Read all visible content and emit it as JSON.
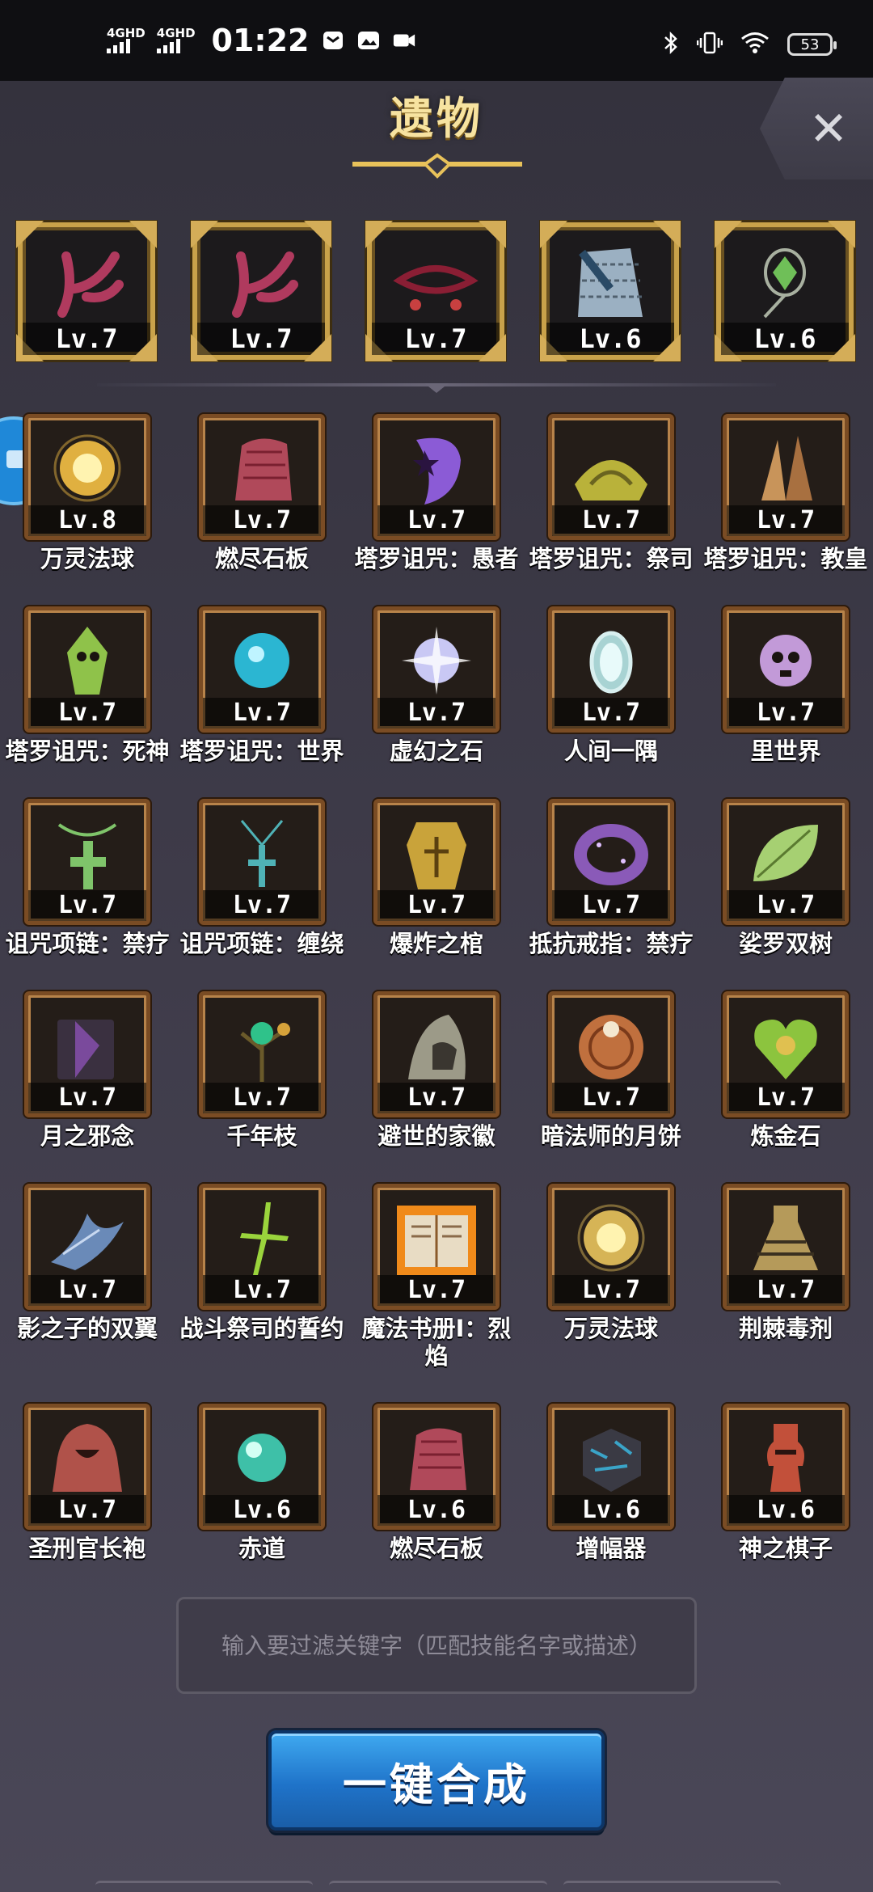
{
  "status_bar": {
    "network1": "4GHD",
    "network2": "4GHD",
    "time": "01:22",
    "battery": "53"
  },
  "header": {
    "title": "遗物",
    "close_icon": "close-icon"
  },
  "equipped": [
    {
      "level": "Lv.7",
      "icon": "antler-relic-icon",
      "color": "#b03a5e"
    },
    {
      "level": "Lv.7",
      "icon": "antler-relic-icon",
      "color": "#b03a5e"
    },
    {
      "level": "Lv.7",
      "icon": "rope-charm-icon",
      "color": "#8a1e34"
    },
    {
      "level": "Lv.6",
      "icon": "chain-mail-icon",
      "color": "#9bb0c2"
    },
    {
      "level": "Lv.6",
      "icon": "crystal-amulet-icon",
      "color": "#6fbf58"
    }
  ],
  "relics": [
    {
      "name": "万灵法球",
      "level": "Lv.8",
      "icon": "golden-orb-icon",
      "color": "#e0b040"
    },
    {
      "name": "燃尽石板",
      "level": "Lv.7",
      "icon": "stone-tablet-icon",
      "color": "#b0495a"
    },
    {
      "name": "塔罗诅咒：愚者",
      "level": "Lv.7",
      "icon": "tarot-fool-icon",
      "color": "#8b5bd6"
    },
    {
      "name": "塔罗诅咒：祭司",
      "level": "Lv.7",
      "icon": "tarot-priest-icon",
      "color": "#b9b23a"
    },
    {
      "name": "塔罗诅咒：教皇",
      "level": "Lv.7",
      "icon": "tarot-pope-icon",
      "color": "#c8945a"
    },
    {
      "name": "塔罗诅咒：死神",
      "level": "Lv.7",
      "icon": "tarot-death-icon",
      "color": "#8fc24a"
    },
    {
      "name": "塔罗诅咒：世界",
      "level": "Lv.7",
      "icon": "tarot-world-icon",
      "color": "#2bb6d2"
    },
    {
      "name": "虚幻之石",
      "level": "Lv.7",
      "icon": "illusion-stone-icon",
      "color": "#c9c8f4"
    },
    {
      "name": "人间一隅",
      "level": "Lv.7",
      "icon": "mirror-icon",
      "color": "#a8d3d3"
    },
    {
      "name": "里世界",
      "level": "Lv.7",
      "icon": "skull-orb-icon",
      "color": "#c29ad8"
    },
    {
      "name": "诅咒项链：禁疗",
      "level": "Lv.7",
      "icon": "cross-necklace-icon",
      "color": "#7fc46a"
    },
    {
      "name": "诅咒项链：缠绕",
      "level": "Lv.7",
      "icon": "cross-pendant-icon",
      "color": "#4fb2b6"
    },
    {
      "name": "爆炸之棺",
      "level": "Lv.7",
      "icon": "coffin-icon",
      "color": "#c9a33a"
    },
    {
      "name": "抵抗戒指：禁疗",
      "level": "Lv.7",
      "icon": "ring-icon",
      "color": "#8a5ab8"
    },
    {
      "name": "娑罗双树",
      "level": "Lv.7",
      "icon": "leaf-icon",
      "color": "#a6d072"
    },
    {
      "name": "月之邪念",
      "level": "Lv.7",
      "icon": "dark-book-icon",
      "color": "#7a4a9c"
    },
    {
      "name": "千年枝",
      "level": "Lv.7",
      "icon": "branch-icon",
      "color": "#2fc28a"
    },
    {
      "name": "避世的家徽",
      "level": "Lv.7",
      "icon": "hood-crest-icon",
      "color": "#9c9a88"
    },
    {
      "name": "暗法师的月饼",
      "level": "Lv.7",
      "icon": "mooncake-icon",
      "color": "#c0703e"
    },
    {
      "name": "炼金石",
      "level": "Lv.7",
      "icon": "heart-stone-icon",
      "color": "#8cc43e"
    },
    {
      "name": "影之子的双翼",
      "level": "Lv.7",
      "icon": "shadow-wing-icon",
      "color": "#6a8ab8"
    },
    {
      "name": "战斗祭司的誓约",
      "level": "Lv.7",
      "icon": "green-cross-icon",
      "color": "#9ad43c"
    },
    {
      "name": "魔法书册Ⅰ：烈焰",
      "level": "Lv.7",
      "icon": "fire-book-icon",
      "color": "#e08a2a"
    },
    {
      "name": "万灵法球",
      "level": "Lv.7",
      "icon": "golden-orb-icon",
      "color": "#d6b456"
    },
    {
      "name": "荆棘毒剂",
      "level": "Lv.7",
      "icon": "thorn-flask-icon",
      "color": "#b59a5a"
    },
    {
      "name": "圣刑官长袍",
      "level": "Lv.7",
      "icon": "robe-icon",
      "color": "#b0524a"
    },
    {
      "name": "赤道",
      "level": "Lv.6",
      "icon": "teal-orb-icon",
      "color": "#3ec0a8"
    },
    {
      "name": "燃尽石板",
      "level": "Lv.6",
      "icon": "stone-tablet-icon",
      "color": "#b0495a"
    },
    {
      "name": "增幅器",
      "level": "Lv.6",
      "icon": "amplifier-cube-icon",
      "color": "#3aa4c8"
    },
    {
      "name": "神之棋子",
      "level": "Lv.6",
      "icon": "chess-helm-icon",
      "color": "#c2503a"
    }
  ],
  "filter": {
    "placeholder": "输入要过滤关键字（匹配技能名字或描述）"
  },
  "actions": {
    "merge_all": "一键合成"
  }
}
